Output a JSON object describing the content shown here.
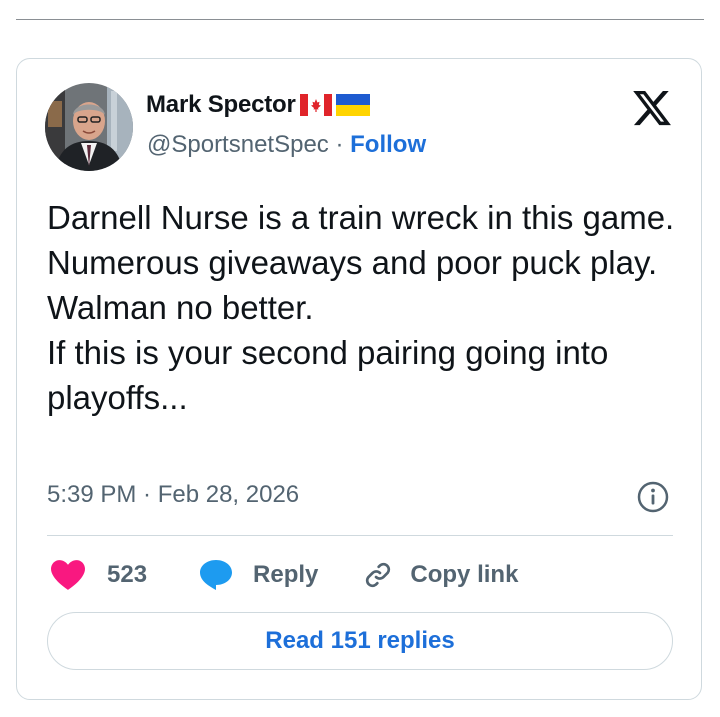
{
  "author": {
    "name": "Mark Spector",
    "handle": "@SportsnetSpec",
    "separator": " · ",
    "follow_label": "Follow",
    "flags": [
      "canada-flag",
      "ukraine-flag"
    ]
  },
  "tweet": {
    "text": "Darnell Nurse is a train wreck in this game. Numerous giveaways and poor puck play.\nWalman no better.\nIf this is your second pairing going into playoffs...",
    "timestamp": "5:39 PM · Feb 28, 2026"
  },
  "actions": {
    "like_count": "523",
    "reply_label": "Reply",
    "copy_label": "Copy link"
  },
  "read_replies_label": "Read 151 replies",
  "colors": {
    "accent": "#1d6fd9",
    "heart": "#f91880",
    "reply_bubble": "#1d9bf0",
    "text": "#0f1419",
    "muted": "#536471",
    "border": "#cfd9de"
  },
  "icons": [
    "x-logo-icon",
    "info-icon",
    "heart-icon",
    "reply-bubble-icon",
    "link-icon"
  ]
}
